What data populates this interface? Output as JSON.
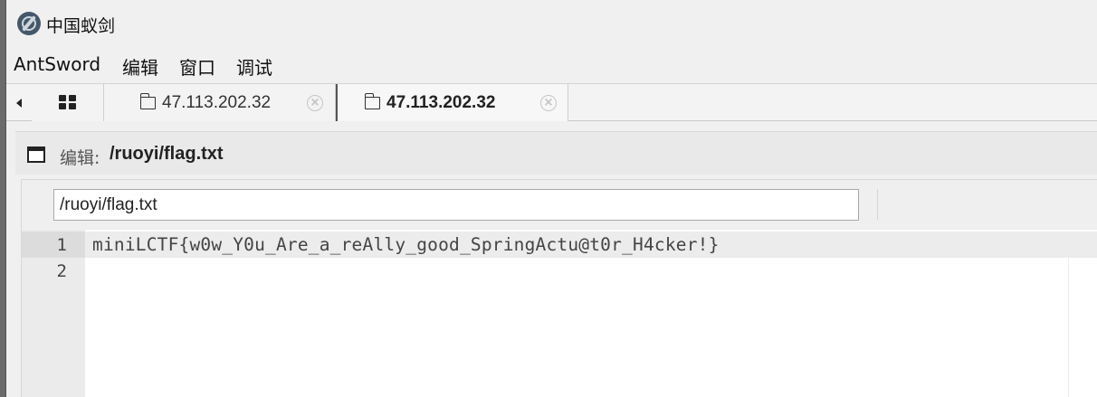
{
  "window": {
    "title": "中国蚁剑",
    "icon": "antsword-logo-icon"
  },
  "menubar": {
    "items": [
      "AntSword",
      "编辑",
      "窗口",
      "调试"
    ]
  },
  "tabs": [
    {
      "type": "grid",
      "icon": "grid-icon",
      "active": false
    },
    {
      "type": "host",
      "icon": "folder-icon",
      "label": "47.113.202.32",
      "active": false
    },
    {
      "type": "host",
      "icon": "folder-icon",
      "label": "47.113.202.32",
      "active": true
    }
  ],
  "editor_panel": {
    "title_prefix": "编辑:",
    "title_path": "/ruoyi/flag.txt",
    "path_input_value": "/ruoyi/flag.txt"
  },
  "code": {
    "lines": [
      {
        "number": "1",
        "text": "miniLCTF{w0w_Y0u_Are_a_reAlly_good_SpringActu@t0r_H4cker!}",
        "active": true
      },
      {
        "number": "2",
        "text": "",
        "active": false
      }
    ]
  },
  "colors": {
    "window_bg": "#f0f0f0",
    "gutter_bg": "#ebebeb",
    "active_line_bg": "#ececec",
    "code_text": "#444444"
  }
}
